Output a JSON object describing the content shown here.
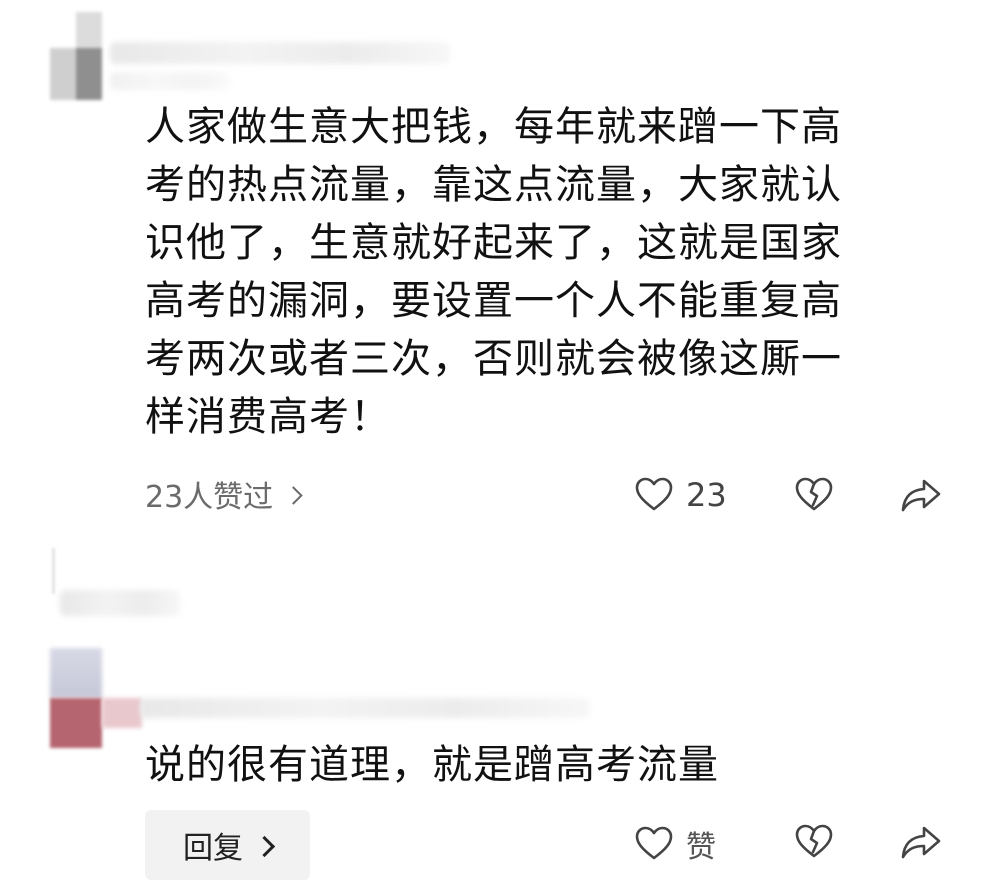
{
  "comments": [
    {
      "text_lines": [
        "人家做生意大把钱，每年就来蹭一下高",
        "考的热点流量，靠这点流量，大家就认",
        "识他了，生意就好起来了，这就是国家",
        "高考的漏洞，要设置一个人不能重复高",
        "考两次或者三次，否则就会被像这厮一",
        "样消费高考！"
      ],
      "liked_by_label": "23人赞过",
      "like_count": "23",
      "icons": {
        "like": "heart-icon",
        "dislike": "broken-heart-icon",
        "share": "share-arrow-icon",
        "chevron": "chevron-right-icon"
      }
    },
    {
      "text_lines": [
        "说的很有道理，就是蹭高考流量"
      ],
      "reply_label": "回复",
      "like_label": "赞",
      "icons": {
        "like": "heart-icon",
        "dislike": "broken-heart-icon",
        "share": "share-arrow-icon",
        "chevron": "chevron-right-icon"
      }
    }
  ],
  "colors": {
    "text": "#111111",
    "secondary_text": "#6b6b6b",
    "icon": "#444444",
    "reply_button_bg": "#f2f2f2",
    "avatar_accent": "#b5656f"
  }
}
